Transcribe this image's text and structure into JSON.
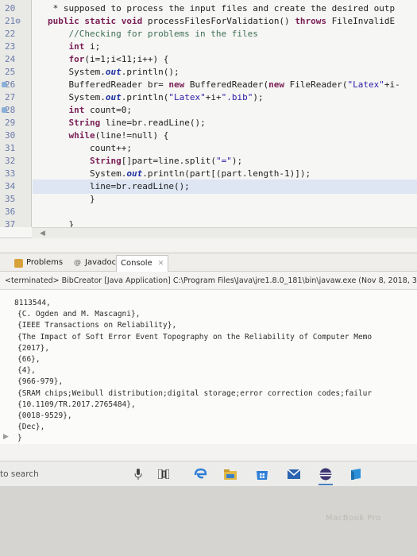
{
  "editor": {
    "lines": [
      {
        "num": "20",
        "text": "   * supposed to process the input files and create the desired outp"
      },
      {
        "num": "21⊖",
        "text": "  public static void processFilesForValidation() throws FileInvalidE"
      },
      {
        "num": "22",
        "text": "      //Checking for problems in the files"
      },
      {
        "num": "23",
        "text": "      int i;"
      },
      {
        "num": "24",
        "text": "      for(i=1;i<11;i++) {"
      },
      {
        "num": "25",
        "text": "      System.out.println();"
      },
      {
        "num": "26",
        "text": "      BufferedReader br= new BufferedReader(new FileReader(\"Latex\"+i-"
      },
      {
        "num": "27",
        "text": "      System.out.println(\"Latex\"+i+\".bib\");"
      },
      {
        "num": "28",
        "text": "      int count=0;"
      },
      {
        "num": "29",
        "text": "      String line=br.readLine();"
      },
      {
        "num": "30",
        "text": "      while(line!=null) {"
      },
      {
        "num": "31",
        "text": "          count++;"
      },
      {
        "num": "32",
        "text": "          String[]part=line.split(\"=\");"
      },
      {
        "num": "33",
        "text": "          System.out.println(part[(part.length-1)]);"
      },
      {
        "num": "34",
        "text": "          line=br.readLine();"
      },
      {
        "num": "35",
        "text": "          }"
      },
      {
        "num": "36",
        "text": ""
      },
      {
        "num": "37",
        "text": "      }"
      }
    ],
    "highlighted_line": "34"
  },
  "tabs": {
    "problems": "Problems",
    "javadoc": "Javadoc",
    "console": "Console",
    "javadoc_glyph": "@",
    "close_glyph": "✕"
  },
  "console_status": "<terminated> BibCreator [Java Application] C:\\Program Files\\Java\\jre1.8.0_181\\bin\\javaw.exe (Nov 8, 2018, 3:",
  "console_output": [
    "8113544,",
    "{C. Ogden and M. Mascagni},",
    "{IEEE Transactions on Reliability},",
    "{The Impact of Soft Error Event Topography on the Reliability of Computer Memo",
    "{2017},",
    "{66},",
    "{4},",
    "{966-979},",
    "{SRAM chips;Weibull distribution;digital storage;error correction codes;failur",
    "{10.1109/TR.2017.2765484},",
    "{0018-9529},",
    "{Dec},",
    "}"
  ],
  "taskbar": {
    "search_text": "to search"
  },
  "bezel": {
    "brand": "MacBook Pro"
  },
  "colors": {
    "accent": "#4a7fc0",
    "keyword": "#7a1f55",
    "string": "#2a1ba8"
  }
}
